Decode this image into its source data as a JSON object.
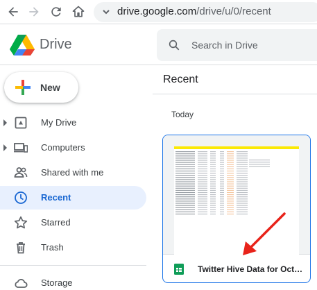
{
  "browser": {
    "url_host": "drive.google.com",
    "url_path": "/drive/u/0/recent"
  },
  "app": {
    "brand": "Drive",
    "search_placeholder": "Search in Drive"
  },
  "sidebar": {
    "new_label": "New",
    "items": [
      {
        "label": "My Drive",
        "icon": "my-drive-icon"
      },
      {
        "label": "Computers",
        "icon": "computers-icon"
      },
      {
        "label": "Shared with me",
        "icon": "shared-icon"
      },
      {
        "label": "Recent",
        "icon": "clock-icon",
        "active": true
      },
      {
        "label": "Starred",
        "icon": "star-icon"
      },
      {
        "label": "Trash",
        "icon": "trash-icon"
      },
      {
        "label": "Storage",
        "icon": "cloud-icon"
      }
    ]
  },
  "main": {
    "title": "Recent",
    "section": "Today",
    "file": {
      "name": "Twitter Hive Data for October",
      "type": "sheets"
    }
  },
  "colors": {
    "accent": "#1a73e8",
    "active_bg": "#e8f0fe",
    "sheets_green": "#0f9d58",
    "annotation_red": "#e8231a"
  }
}
